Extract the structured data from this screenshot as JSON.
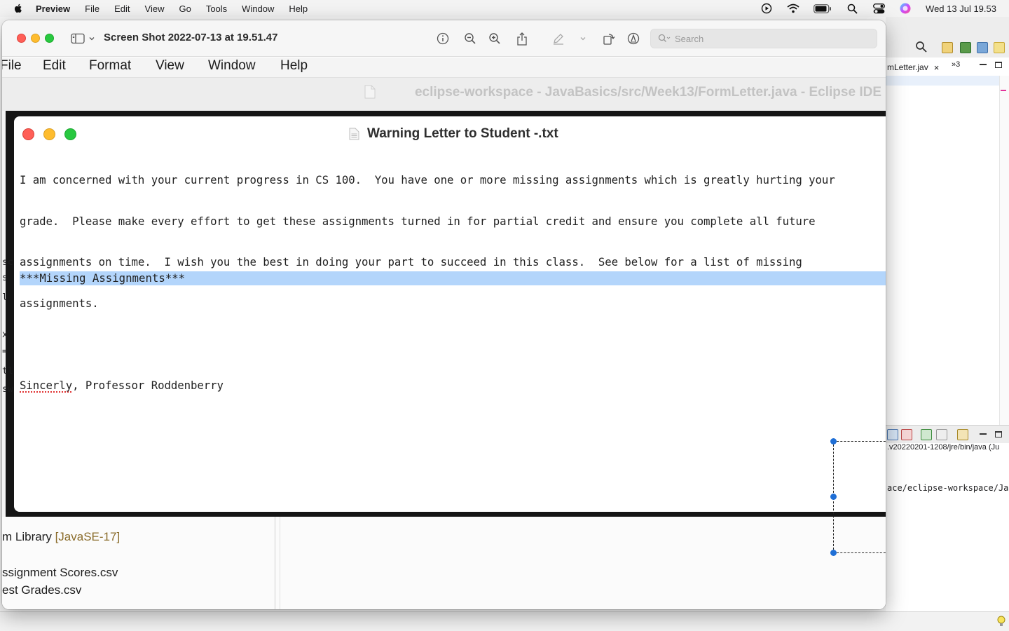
{
  "menubar": {
    "app": "Preview",
    "items": [
      "File",
      "Edit",
      "View",
      "Go",
      "Tools",
      "Window",
      "Help"
    ],
    "clock": "Wed 13 Jul  19.53"
  },
  "preview": {
    "title": "Screen Shot 2022-07-13 at 19.51.47",
    "search_placeholder": "Search"
  },
  "screenshot": {
    "menubar": [
      "File",
      "Edit",
      "Format",
      "View",
      "Window",
      "Help"
    ],
    "eclipse_title": "eclipse-workspace - JavaBasics/src/Week13/FormLetter.java - Eclipse IDE",
    "textedit_title": "Warning Letter to Student -.txt",
    "body_lines": [
      "I am concerned with your current progress in CS 100.  You have one or more missing assignments which is greatly hurting your",
      "grade.  Please make every effort to get these assignments turned in for partial credit and ensure you complete all future",
      "assignments on time.  I wish you the best in doing your part to succeed in this class.  See below for a list of missing",
      "assignments."
    ],
    "signoff_word": "Sincerly",
    "signoff_rest": ", Professor Roddenberry",
    "missing_heading": "***Missing Assignments***",
    "left_edge_chars": [
      "sc",
      "s",
      "l",
      "x",
      "=",
      "tl",
      "sw"
    ],
    "lower_items": {
      "library_prefix": "m Library ",
      "library_tag": "[JavaSE-17]",
      "file1": "ssignment Scores.csv",
      "file2": "est Grades.csv"
    }
  },
  "eclipse": {
    "tab_label": "mLetter.jav",
    "tab_close": "×",
    "tab_more": "»3",
    "console_path": ".v20220201-1208/jre/bin/java  (Ju",
    "console_cwd": "ace/eclipse-workspace/Ja"
  },
  "colors": {
    "close": "#ff5f57",
    "minimize": "#febc2e",
    "zoom": "#28c840",
    "selection": "#b3d5fb"
  }
}
